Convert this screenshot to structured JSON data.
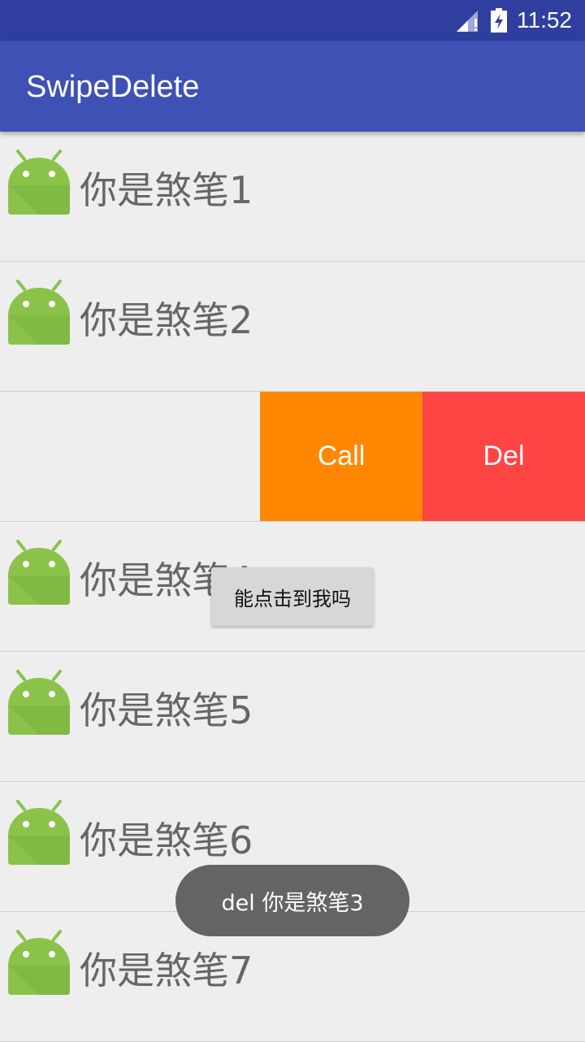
{
  "status_bar": {
    "time": "11:52"
  },
  "app_bar": {
    "title": "SwipeDelete"
  },
  "list": {
    "items": [
      {
        "label": "你是煞笔1"
      },
      {
        "label": "你是煞笔2"
      },
      {
        "label": ""
      },
      {
        "label": "你是煞笔4"
      },
      {
        "label": "你是煞笔5"
      },
      {
        "label": "你是煞笔6"
      },
      {
        "label": "你是煞笔7"
      }
    ],
    "swiped_actions": {
      "call_label": "Call",
      "del_label": "Del",
      "call_color": "#ff8800",
      "del_color": "#ff4444"
    },
    "inline_button_label": "能点击到我吗"
  },
  "toast": {
    "text": "del 你是煞笔3"
  },
  "colors": {
    "status_bar": "#303f9f",
    "app_bar": "#3f51b5",
    "background": "#eeeeee",
    "android_green": "#8bc34a"
  }
}
